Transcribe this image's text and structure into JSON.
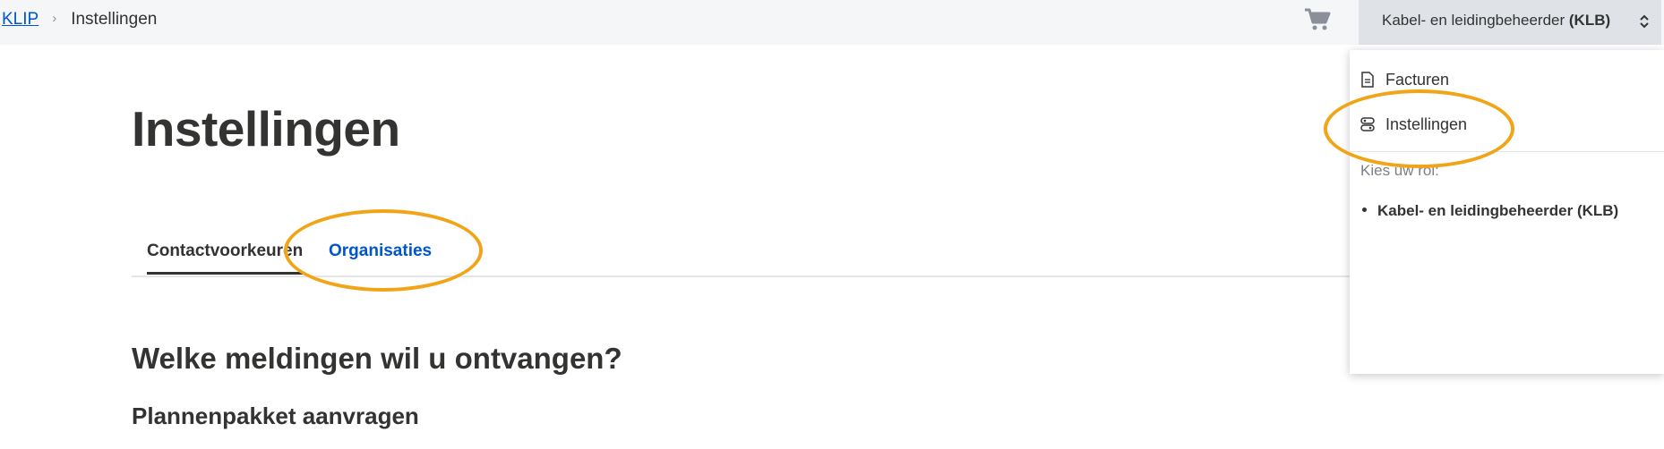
{
  "breadcrumb": {
    "root": "KLIP",
    "current": "Instellingen"
  },
  "header": {
    "cart_icon": "shopping-cart-icon",
    "role_switch": {
      "label_prefix": "Kabel- en leidingbeheerder ",
      "label_code": "(KLB)"
    }
  },
  "page": {
    "title": "Instellingen"
  },
  "tabs": [
    {
      "label": "Contactvoorkeuren",
      "active": true
    },
    {
      "label": "Organisaties",
      "active": false
    }
  ],
  "content": {
    "heading": "Welke meldingen wil u ontvangen?",
    "subheading": "Plannenpakket aanvragen"
  },
  "dropdown": {
    "items": [
      {
        "label": "Facturen",
        "icon": "document-icon"
      },
      {
        "label": "Instellingen",
        "icon": "settings-toggle-icon"
      }
    ],
    "role_label": "Kies uw rol:",
    "roles": [
      "Kabel- en leidingbeheerder (KLB)"
    ]
  },
  "colors": {
    "link": "#0055cc",
    "highlight": "#f2a417",
    "topbar": "#f5f6f8",
    "role_switch_bg": "#dfe3e8"
  }
}
